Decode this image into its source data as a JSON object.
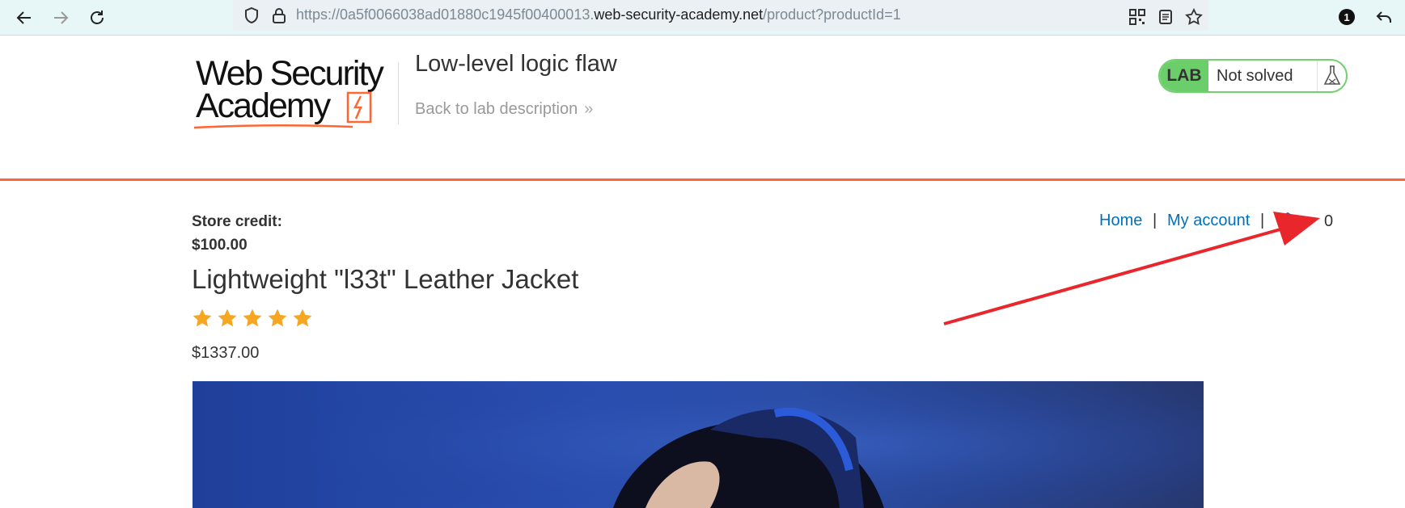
{
  "browser": {
    "url_prefix": "https://0a5f0066038ad01880c1945f00400013.",
    "url_host": "web-security-academy.net",
    "url_path": "/product?productId=1",
    "notification_count": "1"
  },
  "header": {
    "logo_line1": "Web Security",
    "logo_line2": "Academy",
    "lab_title": "Low-level logic flaw",
    "back_link": "Back to lab description",
    "lab_badge": "LAB",
    "lab_status": "Not solved"
  },
  "store": {
    "credit_label": "Store credit:",
    "credit_value": "$100.00"
  },
  "nav": {
    "home": "Home",
    "separator": "|",
    "my_account": "My account",
    "cart_count": "0"
  },
  "product": {
    "title": "Lightweight \"l33t\" Leather Jacket",
    "rating_stars": 5,
    "price": "$1337.00"
  },
  "colors": {
    "accent_orange": "#ff6633",
    "lab_green": "#6cce6a",
    "link_blue": "#0071bc",
    "star_gold": "#f5a623",
    "annotation_red": "#e8262b"
  }
}
